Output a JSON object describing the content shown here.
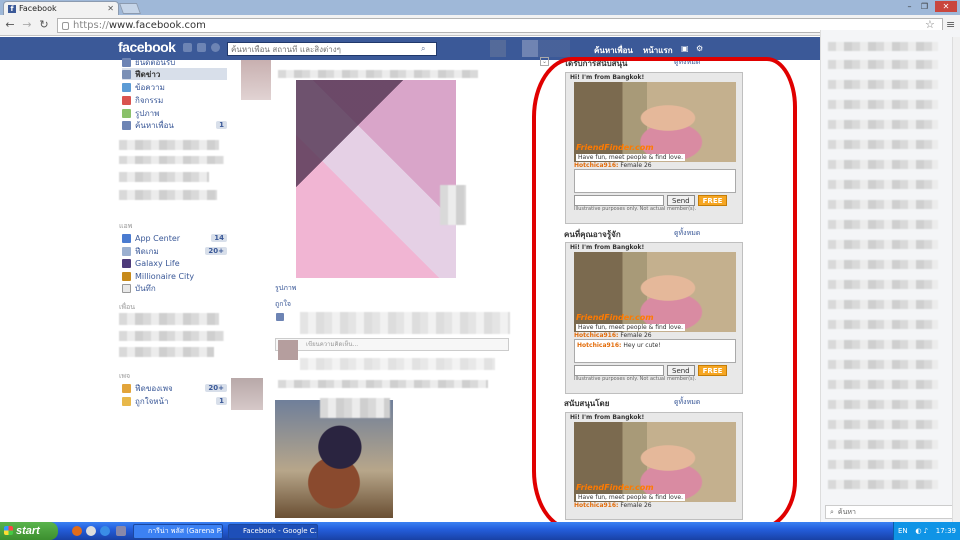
{
  "browser": {
    "tab_title": "Facebook",
    "url_scheme": "https://",
    "url_host": "www.facebook.com"
  },
  "facebook": {
    "logo": "facebook",
    "search_placeholder": "ค้นหาเพื่อน สถานที่ และสิ่งต่างๆ",
    "header_links": [
      "ค้นหาเพื่อน",
      "หน้าแรก"
    ]
  },
  "sidebar": {
    "top_items": [
      {
        "label": "ยินดีต้อนรับ",
        "icon": "welcome-icon",
        "count": ""
      },
      {
        "label": "ฟีดข่าว",
        "icon": "newsfeed-icon",
        "count": ""
      },
      {
        "label": "ข้อความ",
        "icon": "messages-icon",
        "count": ""
      },
      {
        "label": "กิจกรรม",
        "icon": "events-icon",
        "count": ""
      },
      {
        "label": "รูปภาพ",
        "icon": "photos-icon",
        "count": ""
      },
      {
        "label": "ค้นหาเพื่อน",
        "icon": "find-friends-icon",
        "count": "1"
      }
    ],
    "apps_header": "แอพ",
    "apps": [
      {
        "label": "App Center",
        "count": "14"
      },
      {
        "label": "ฟีดเกม",
        "count": "20+"
      },
      {
        "label": "Galaxy Life",
        "count": ""
      },
      {
        "label": "Millionaire City",
        "count": ""
      },
      {
        "label": "บันทึก",
        "count": ""
      }
    ],
    "friends_header": "เพื่อน",
    "pages_header": "เพจ",
    "pages": [
      {
        "label": "ฟีดของเพจ",
        "count": "20+"
      },
      {
        "label": "ถูกใจหน้า",
        "count": "1"
      }
    ]
  },
  "feed": {
    "post1_actions": "รูปภาพ",
    "post1_like": "ถูกใจ",
    "comment_placeholder": "เขียนความคิดเห็น..."
  },
  "ads": {
    "section_labels": [
      "ได้รับการสนับสนุน",
      "คนที่คุณอาจรู้จัก",
      "สนับสนุนโดย"
    ],
    "see_all": "ดูทั้งหมด",
    "headline": "Hi! I'm from Bangkok!",
    "brand": "FriendFinder.com",
    "tagline": "Have fun, meet people & find love.",
    "user_name": "Hotchica916:",
    "user_info": "Female 26",
    "chat_message": "Hey ur cute!",
    "send_label": "Send",
    "join_label": "FREE",
    "disclaimer": "Illustrative purposes only. Not actual member(s)."
  },
  "chat": {
    "search_placeholder": "ค้นหา"
  },
  "taskbar": {
    "start_label": "start",
    "tasks": [
      "การีน่า พลัส (Garena P...",
      "Facebook - Google C..."
    ],
    "lang": "EN",
    "clock": "17:39"
  },
  "colors": {
    "facebook_blue": "#3b5998",
    "annotation_red": "#e00000",
    "xp_taskbar": "#245edc"
  }
}
